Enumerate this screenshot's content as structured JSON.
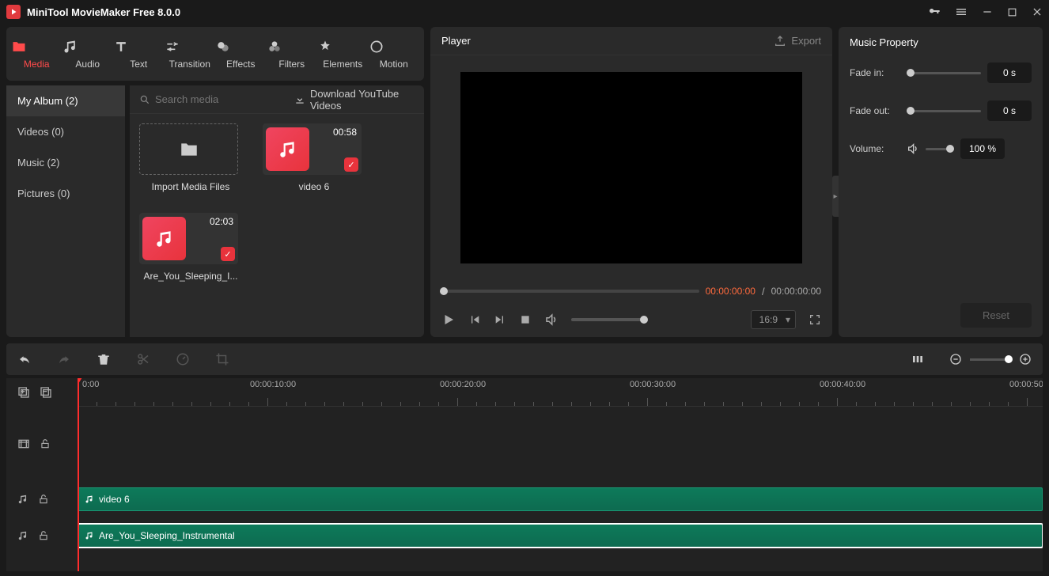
{
  "app": {
    "title": "MiniTool MovieMaker Free 8.0.0"
  },
  "toolbar_tabs": {
    "media": "Media",
    "audio": "Audio",
    "text": "Text",
    "transition": "Transition",
    "effects": "Effects",
    "filters": "Filters",
    "elements": "Elements",
    "motion": "Motion"
  },
  "album_list": {
    "my_album": "My Album (2)",
    "videos": "Videos (0)",
    "music": "Music (2)",
    "pictures": "Pictures (0)"
  },
  "media_header": {
    "search_placeholder": "Search media",
    "yt_link": "Download YouTube Videos"
  },
  "media_items": {
    "import_label": "Import Media Files",
    "item1_duration": "00:58",
    "item1_caption": "video 6",
    "item2_duration": "02:03",
    "item2_caption": "Are_You_Sleeping_I..."
  },
  "player": {
    "title": "Player",
    "export_label": "Export",
    "time_current": "00:00:00:00",
    "time_total": "00:00:00:00",
    "aspect": "16:9"
  },
  "properties": {
    "title": "Music Property",
    "fade_in_label": "Fade in:",
    "fade_in_value": "0 s",
    "fade_out_label": "Fade out:",
    "fade_out_value": "0 s",
    "volume_label": "Volume:",
    "volume_value": "100 %",
    "reset": "Reset"
  },
  "timeline": {
    "ruler": {
      "t0": "0:00",
      "t1": "00:00:10:00",
      "t2": "00:00:20:00",
      "t3": "00:00:30:00",
      "t4": "00:00:40:00",
      "t5": "00:00:50:"
    },
    "clip1_label": "video 6",
    "clip2_label": "Are_You_Sleeping_Instrumental"
  }
}
